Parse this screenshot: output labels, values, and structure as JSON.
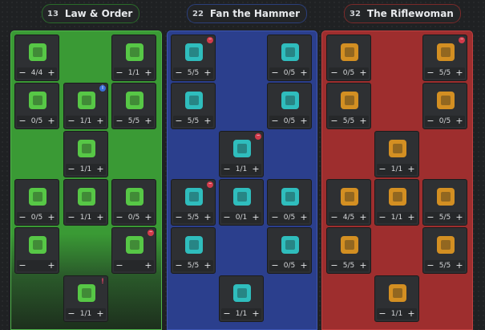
{
  "trees": [
    {
      "points": "13",
      "title": "Law & Order",
      "color": "#3a9a35",
      "icon_color": "#5ee24a"
    },
    {
      "points": "22",
      "title": "Fan the Hammer",
      "color": "#2b3f8d",
      "icon_color": "#2fd6d6"
    },
    {
      "points": "32",
      "title": "The Riflewoman",
      "color": "#9e2e2e",
      "icon_color": "#f0a020"
    }
  ],
  "nodes": {
    "g1": {
      "icon": "shield-badge-icon",
      "value": "4/4"
    },
    "g2": {
      "icon": "sheriff-star-icon",
      "value": "1/1"
    },
    "g3": {
      "icon": "crossed-hammer-icon",
      "value": "0/5"
    },
    "g4": {
      "icon": "lasso-hand-icon",
      "value": "1/1"
    },
    "g5": {
      "icon": "gold-hand-icon",
      "value": "5/5"
    },
    "g6": {
      "icon": "lasso-rope-icon",
      "value": "1/1"
    },
    "g7": {
      "icon": "punch-fist-icon",
      "value": "0/5"
    },
    "g8": {
      "icon": "clover-icon",
      "value": "1/1"
    },
    "g9": {
      "icon": "revolver-cylinder-icon",
      "value": "0/5"
    },
    "g10": {
      "icon": "shattered-glass-icon",
      "value": ""
    },
    "g11": {
      "icon": "revolver-icon",
      "value": ""
    },
    "g12": {
      "icon": "lightning-tree-icon",
      "value": "1/1"
    },
    "b1": {
      "icon": "fan-hammer-icon",
      "value": "5/5"
    },
    "b2": {
      "icon": "bullet-cylinder-icon",
      "value": "0/5"
    },
    "b3": {
      "icon": "bullets-stack-icon",
      "value": "5/5"
    },
    "b4": {
      "icon": "bottle-icon",
      "value": "0/5"
    },
    "b5": {
      "icon": "bomb-icon",
      "value": "1/1"
    },
    "b6": {
      "icon": "running-rabbit-icon",
      "value": "5/5"
    },
    "b7": {
      "icon": "double-barrel-icon",
      "value": "0/1"
    },
    "b8": {
      "icon": "gun-barrel-icon",
      "value": "0/5"
    },
    "b9": {
      "icon": "dynamite-icon",
      "value": "5/5"
    },
    "b10": {
      "icon": "reload-hand-icon",
      "value": "0/5"
    },
    "b11": {
      "icon": "skull-crossbones-icon",
      "value": "1/1"
    },
    "r1": {
      "icon": "rifle-scope-icon",
      "value": "0/5"
    },
    "r2": {
      "icon": "rifle-gold-icon",
      "value": "5/5"
    },
    "r3": {
      "icon": "claw-marks-icon",
      "value": "5/5"
    },
    "r4": {
      "icon": "pocket-watch-icon",
      "value": "0/5"
    },
    "r5": {
      "icon": "fist-bullets-icon",
      "value": "1/1"
    },
    "r6": {
      "icon": "muzzle-flash-icon",
      "value": "4/5"
    },
    "r7": {
      "icon": "bullet-fist-icon",
      "value": "1/1"
    },
    "r8": {
      "icon": "card-target-icon",
      "value": "5/5"
    },
    "r9": {
      "icon": "tornado-icon",
      "value": "5/5"
    },
    "r10": {
      "icon": "tombstone-icon",
      "value": "5/5"
    },
    "r11": {
      "icon": "crossed-rifles-icon",
      "value": "1/1"
    }
  },
  "minus_label": "−",
  "plus_label": "+"
}
